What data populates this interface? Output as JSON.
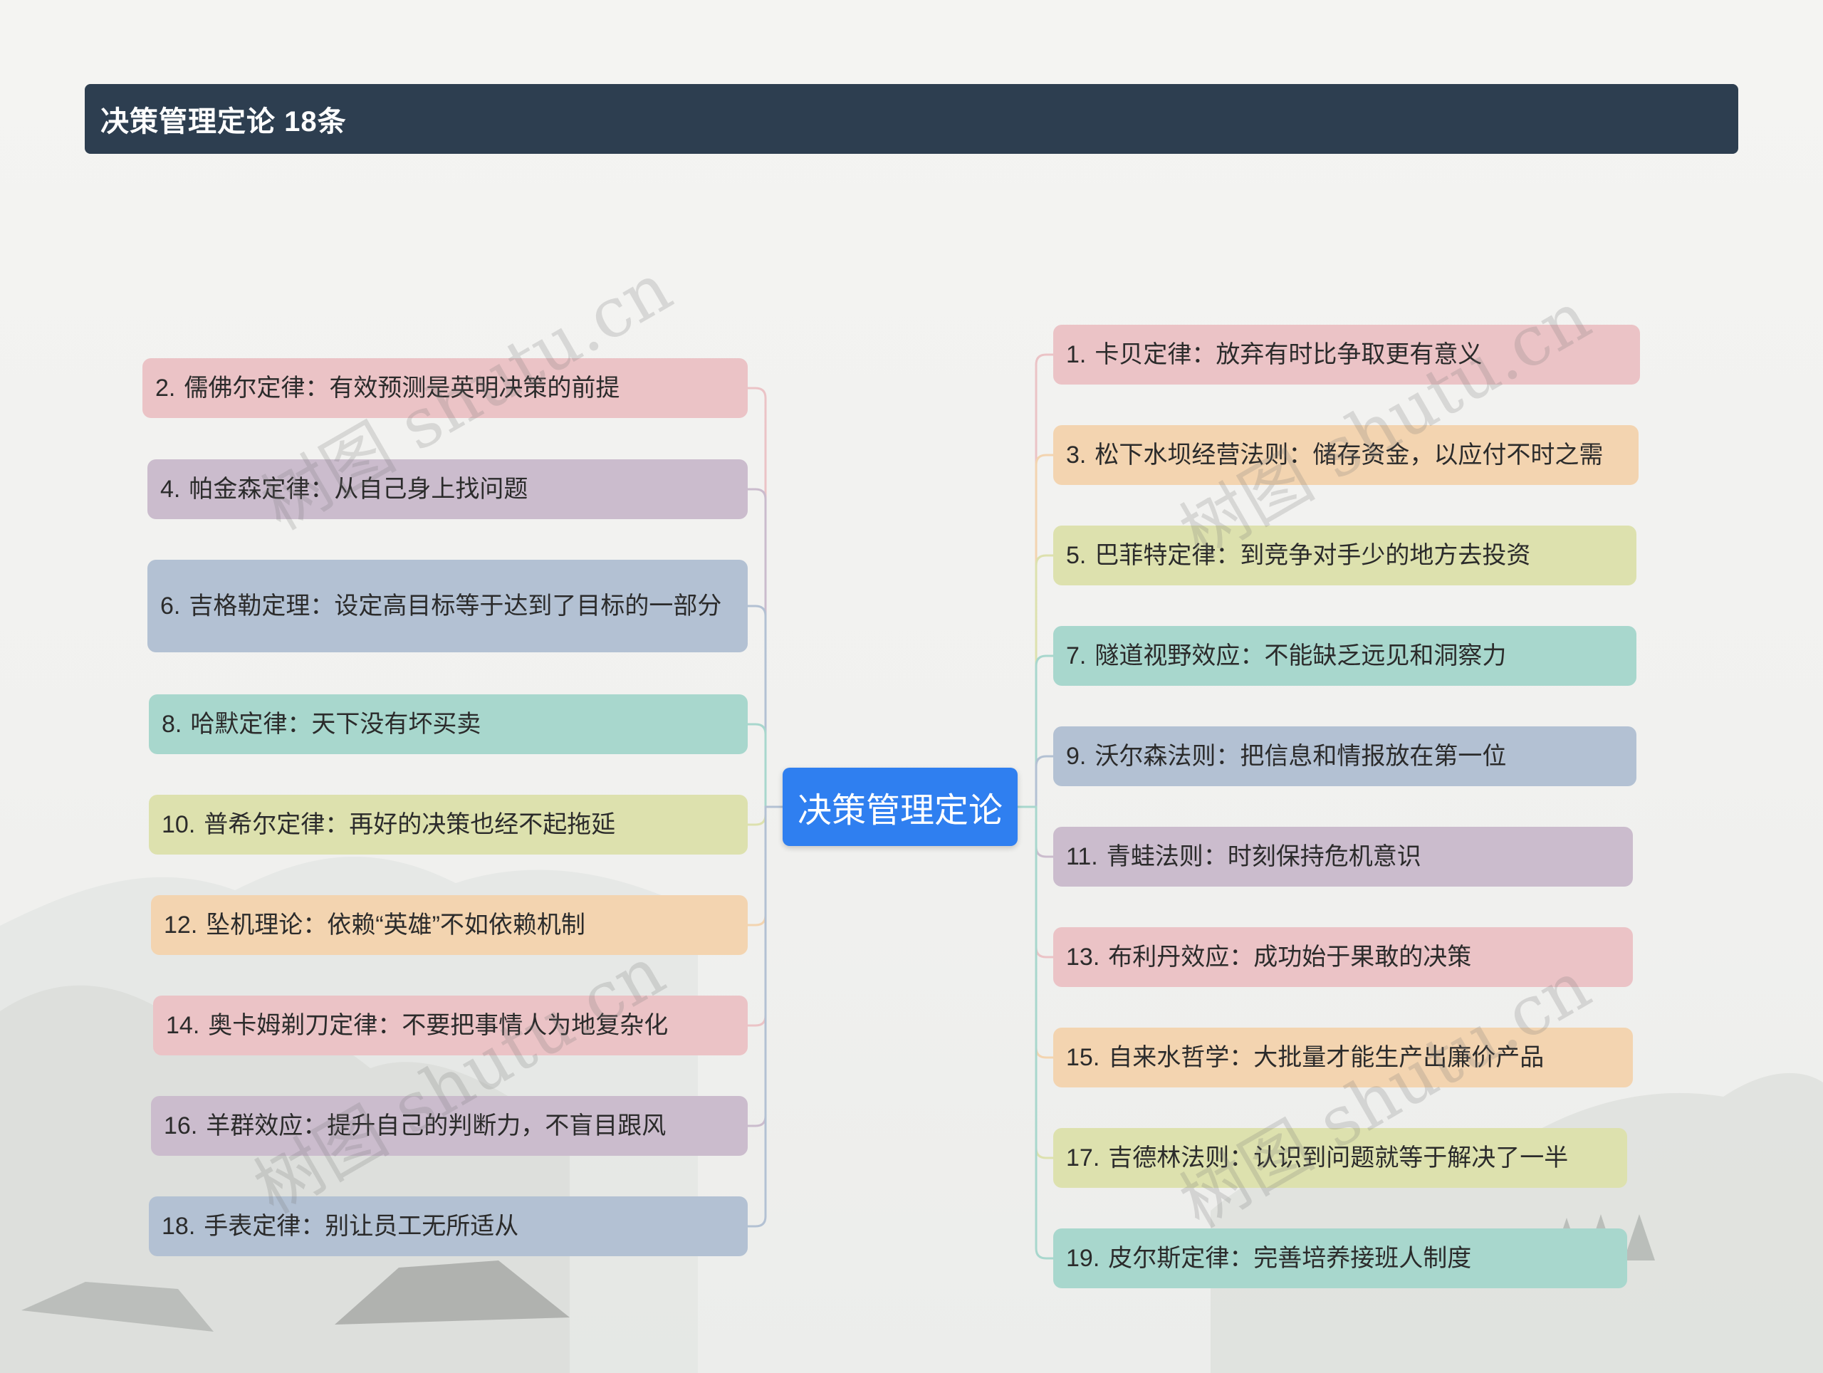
{
  "header": {
    "title": "决策管理定论 18条"
  },
  "root": {
    "label": "决策管理定论"
  },
  "colors": {
    "pink": "#ebc3c6",
    "purple": "#cbbccd",
    "slate": "#b3c1d3",
    "mint": "#a8d7cd",
    "lime": "#dde1ae",
    "peach": "#f3d4b0",
    "root": "#2f7ff0",
    "header": "#2d3e50"
  },
  "left_nodes": [
    {
      "num": "2.",
      "text": "儒佛尔定律：有效预测是英明决策的前提",
      "color": "pink"
    },
    {
      "num": "4.",
      "text": "帕金森定律：从自己身上找问题",
      "color": "purple"
    },
    {
      "num": "6.",
      "text": "吉格勒定理：设定高目标等于达到了目标的一部分",
      "color": "slate"
    },
    {
      "num": "8.",
      "text": "哈默定律：天下没有坏买卖",
      "color": "mint"
    },
    {
      "num": "10.",
      "text": "普希尔定律：再好的决策也经不起拖延",
      "color": "lime"
    },
    {
      "num": "12.",
      "text": "坠机理论：依赖“英雄”不如依赖机制",
      "color": "peach"
    },
    {
      "num": "14.",
      "text": "奥卡姆剃刀定律：不要把事情人为地复杂化",
      "color": "pink"
    },
    {
      "num": "16.",
      "text": "羊群效应：提升自己的判断力，不盲目跟风",
      "color": "purple"
    },
    {
      "num": "18.",
      "text": "手表定律：别让员工无所适从",
      "color": "slate"
    }
  ],
  "right_nodes": [
    {
      "num": "1.",
      "text": "卡贝定律：放弃有时比争取更有意义",
      "color": "pink"
    },
    {
      "num": "3.",
      "text": "松下水坝经营法则：储存资金，以应付不时之需",
      "color": "peach"
    },
    {
      "num": "5.",
      "text": "巴菲特定律：到竞争对手少的地方去投资",
      "color": "lime"
    },
    {
      "num": "7.",
      "text": "隧道视野效应：不能缺乏远见和洞察力",
      "color": "mint"
    },
    {
      "num": "9.",
      "text": "沃尔森法则：把信息和情报放在第一位",
      "color": "slate"
    },
    {
      "num": "11.",
      "text": "青蛙法则：时刻保持危机意识",
      "color": "purple"
    },
    {
      "num": "13.",
      "text": "布利丹效应：成功始于果敢的决策",
      "color": "pink"
    },
    {
      "num": "15.",
      "text": "自来水哲学：大批量才能生产出廉价产品",
      "color": "peach"
    },
    {
      "num": "17.",
      "text": "吉德林法则：认识到问题就等于解决了一半",
      "color": "lime"
    },
    {
      "num": "19.",
      "text": "皮尔斯定律：完善培养接班人制度",
      "color": "mint"
    }
  ],
  "watermarks": [
    "树图 shutu.cn",
    "树图 shutu.cn",
    "树图 shutu.cn",
    "树图 shutu.cn"
  ]
}
